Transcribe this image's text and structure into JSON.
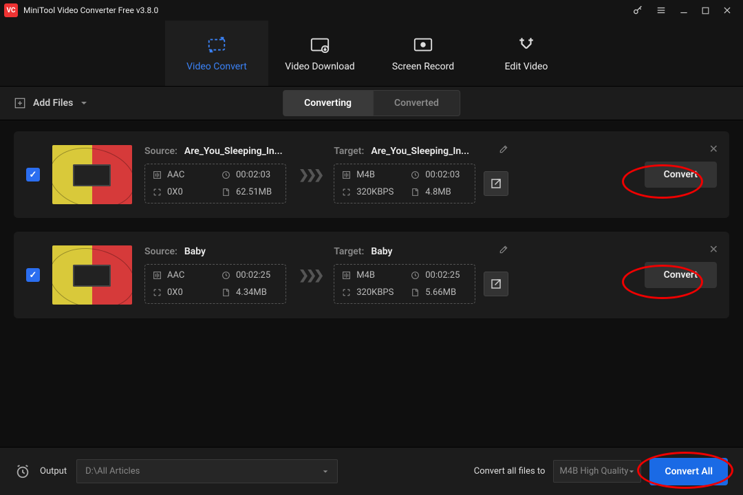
{
  "app": {
    "title": "MiniTool Video Converter Free v3.8.0"
  },
  "nav": {
    "tabs": [
      {
        "label": "Video Convert"
      },
      {
        "label": "Video Download"
      },
      {
        "label": "Screen Record"
      },
      {
        "label": "Edit Video"
      }
    ]
  },
  "toolbar": {
    "add_files": "Add Files",
    "seg_converting": "Converting",
    "seg_converted": "Converted"
  },
  "source_label": "Source:",
  "target_label": "Target:",
  "convert_label": "Convert",
  "items": [
    {
      "source_name": "Are_You_Sleeping_In...",
      "src_codec": "AAC",
      "src_dur": "00:02:03",
      "src_res": "0X0",
      "src_size": "62.51MB",
      "target_name": "Are_You_Sleeping_In...",
      "tgt_codec": "M4B",
      "tgt_dur": "00:02:03",
      "tgt_rate": "320KBPS",
      "tgt_size": "4.8MB"
    },
    {
      "source_name": "Baby",
      "src_codec": "AAC",
      "src_dur": "00:02:25",
      "src_res": "0X0",
      "src_size": "4.34MB",
      "target_name": "Baby",
      "tgt_codec": "M4B",
      "tgt_dur": "00:02:25",
      "tgt_rate": "320KBPS",
      "tgt_size": "5.66MB"
    }
  ],
  "footer": {
    "output_label": "Output",
    "output_path": "D:\\All Articles",
    "convert_all_to": "Convert all files to",
    "format": "M4B High Quality",
    "convert_all": "Convert All"
  }
}
